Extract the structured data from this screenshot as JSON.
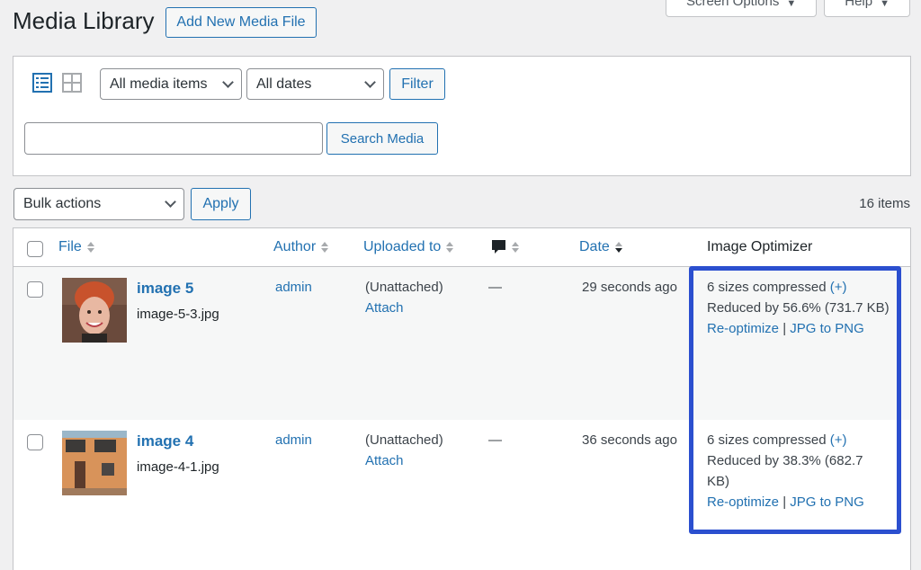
{
  "header": {
    "title": "Media Library",
    "add_new_label": "Add New Media File",
    "screen_options_label": "Screen Options",
    "help_label": "Help"
  },
  "filters": {
    "media_type_selected": "All media items",
    "date_selected": "All dates",
    "filter_label": "Filter",
    "search_value": "",
    "search_button_label": "Search Media"
  },
  "bulk": {
    "selected": "Bulk actions",
    "apply_label": "Apply",
    "items_count": "16 items"
  },
  "columns": {
    "file": "File",
    "author": "Author",
    "uploaded_to": "Uploaded to",
    "date": "Date",
    "optimizer": "Image Optimizer"
  },
  "rows": [
    {
      "title": "image 5",
      "filename": "image-5-3.jpg",
      "author": "admin",
      "uploaded_to": "(Unattached)",
      "attach_label": "Attach",
      "comments": "—",
      "date": "29 seconds ago",
      "opt_sizes": "6 sizes compressed",
      "opt_plus": "(+)",
      "opt_reduced_line1": "Reduced by 56.6% (731.7 KB)",
      "opt_reduced_line2": "",
      "opt_reoptimize": "Re-optimize",
      "opt_sep": "|",
      "opt_convert": "JPG to PNG"
    },
    {
      "title": "image 4",
      "filename": "image-4-1.jpg",
      "author": "admin",
      "uploaded_to": "(Unattached)",
      "attach_label": "Attach",
      "comments": "—",
      "date": "36 seconds ago",
      "opt_sizes": "6 sizes compressed",
      "opt_plus": "(+)",
      "opt_reduced_line1": "Reduced by 38.3% (682.7",
      "opt_reduced_line2": "KB)",
      "opt_reoptimize": "Re-optimize",
      "opt_sep": "|",
      "opt_convert": "JPG to PNG"
    }
  ],
  "colors": {
    "link": "#2271b1",
    "highlight": "#2b4fcf"
  }
}
